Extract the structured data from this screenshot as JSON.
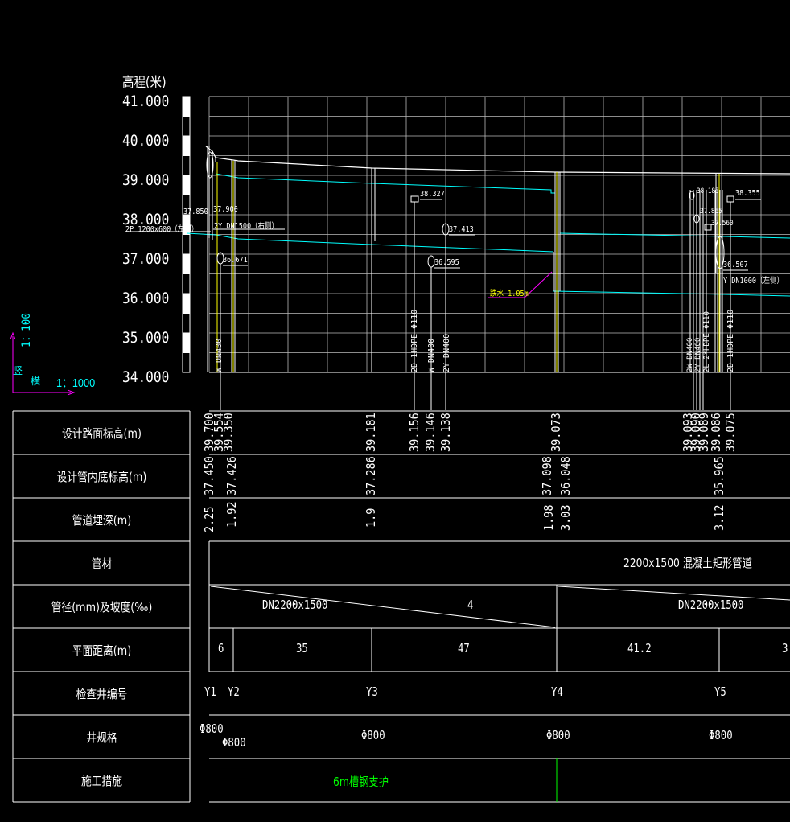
{
  "axis": {
    "title": "高程(米)",
    "ticks": [
      "41.000",
      "40.000",
      "39.000",
      "38.000",
      "37.000",
      "36.000",
      "35.000",
      "34.000"
    ]
  },
  "scale": {
    "vertical": "1：100",
    "horizontal": "1：1000",
    "vertical_label": "竖",
    "horizontal_label": "横"
  },
  "annotations": {
    "elev_37850": "37.850",
    "elev_37900": "37.900",
    "left_pipe": "2P 1200x600（左侧）",
    "y_pipe": "2Y DN1500（右侧）",
    "elev_36671": "36.671",
    "elev_38327": "38.327",
    "elev_37413": "37.413",
    "elev_36595": "36.595",
    "drop": "跌水 1.05m",
    "elev_38355": "38.355",
    "elev_38185": "38.185",
    "elev_37865": "37.865",
    "elev_37560": "37.560",
    "elev_36507": "36.507",
    "y_dn1000": "Y DN1000（左侧）",
    "v_w_dn400_1": "W DN400",
    "v_2d_hdpe": "2D 1HDPE Φ110",
    "v_w_dn400_2": "W DN400",
    "v_2y_dn400": "2Y DN400",
    "v_2w_dn400": "2W DN400",
    "v_2y_dn400b": "2Y DN400",
    "v_2l_hdpe": "2L 2*HDPE Φ110",
    "v_2d_hdpe_b": "2D 1HDPE Φ110"
  },
  "table": {
    "rows": [
      {
        "label": "设计路面标高(m)"
      },
      {
        "label": "设计管内底标高(m)"
      },
      {
        "label": "管道埋深(m)"
      },
      {
        "label": "管材"
      },
      {
        "label": "管径(mm)及坡度(‰)"
      },
      {
        "label": "平面距离(m)"
      },
      {
        "label": "检查井编号"
      },
      {
        "label": "井规格"
      },
      {
        "label": "施工措施"
      }
    ],
    "road_elev": [
      "39.700",
      "39.554",
      "39.350",
      "39.181",
      "39.156",
      "39.146",
      "39.138",
      "39.073",
      "39.093",
      "39.090",
      "39.089",
      "39.086",
      "39.075"
    ],
    "invert_elev": [
      "37.450",
      "37.426",
      "37.286",
      "37.098",
      "36.048",
      "35.965"
    ],
    "depth": [
      "2.25",
      "1.92",
      "1.9",
      "1.98",
      "3.03",
      "3.12"
    ],
    "material": "2200x1500   混凝土矩形管道",
    "size_a": "DN2200x1500",
    "slope_a": "4",
    "size_b": "DN2200x1500",
    "distances": [
      "6",
      "35",
      "47",
      "41.2",
      "3"
    ],
    "wells": [
      "Y1",
      "Y2",
      "Y3",
      "Y4",
      "Y5"
    ],
    "well_spec": [
      "Φ800",
      "Φ800",
      "Φ800",
      "Φ800",
      "Φ800"
    ],
    "measure": "6m槽钢支护"
  },
  "colors": {
    "grid": "#ffffff",
    "road": "#ffffff",
    "pipe": "#00ffff",
    "yellow": "#ffff00",
    "green": "#00ff00",
    "magenta": "#ff00ff"
  }
}
